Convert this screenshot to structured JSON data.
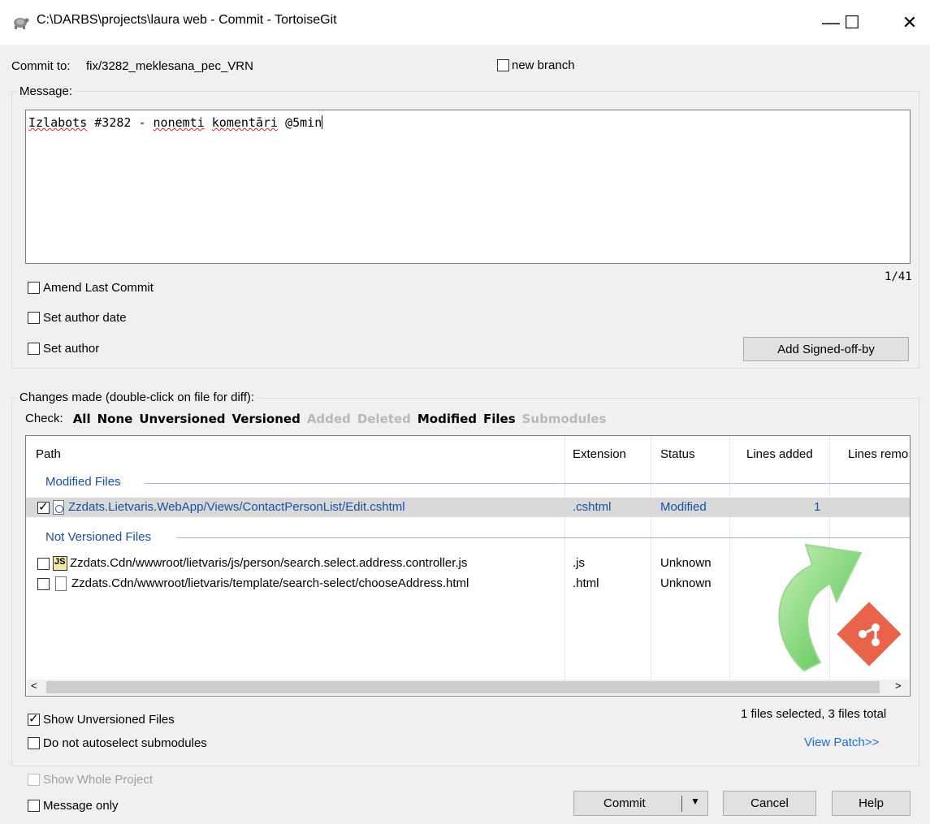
{
  "window": {
    "title": "C:\\DARBS\\projects\\laura web - Commit - TortoiseGit",
    "minimize": "—",
    "maximize": "☐",
    "close": "✕"
  },
  "commit_to": {
    "label": "Commit to:",
    "branch": "fix/3282_meklesana_pec_VRN",
    "new_branch_label": "new branch",
    "new_branch_checked": false
  },
  "message": {
    "group_label": "Message:",
    "text_parts": [
      "Izlabots",
      " #3282 - ",
      "nonemti",
      " ",
      "komentāri",
      " @5min"
    ],
    "counter": "1/41",
    "amend_label": "Amend Last Commit",
    "set_author_date_label": "Set author date",
    "set_author_label": "Set author",
    "signed_off_button": "Add Signed-off-by"
  },
  "changes": {
    "group_label": "Changes made (double-click on file for diff):",
    "check_label": "Check:",
    "check_items": [
      {
        "label": "All",
        "enabled": true
      },
      {
        "label": "None",
        "enabled": true
      },
      {
        "label": "Unversioned",
        "enabled": true
      },
      {
        "label": "Versioned",
        "enabled": true
      },
      {
        "label": "Added",
        "enabled": false
      },
      {
        "label": "Deleted",
        "enabled": false
      },
      {
        "label": "Modified",
        "enabled": true
      },
      {
        "label": "Files",
        "enabled": true
      },
      {
        "label": "Submodules",
        "enabled": false
      }
    ],
    "columns": [
      "Path",
      "Extension",
      "Status",
      "Lines added",
      "Lines remo"
    ],
    "groups": {
      "modified": "Modified Files",
      "not_versioned": "Not Versioned Files"
    },
    "files": [
      {
        "path": "Zzdats.Lietvaris.WebApp/Views/ContactPersonList/Edit.cshtml",
        "ext": ".cshtml",
        "status": "Modified",
        "lines_added": "1",
        "checked": true
      },
      {
        "path": "Zzdats.Cdn/wwwroot/lietvaris/js/person/search.select.address.controller.js",
        "ext": ".js",
        "status": "Unknown",
        "lines_added": "",
        "checked": false
      },
      {
        "path": "Zzdats.Cdn/wwwroot/lietvaris/template/search-select/chooseAddress.html",
        "ext": ".html",
        "status": "Unknown",
        "lines_added": "",
        "checked": false
      }
    ],
    "show_unversioned_label": "Show Unversioned Files",
    "show_unversioned_checked": true,
    "no_autoselect_label": "Do not autoselect submodules",
    "selection_summary": "1 files selected, 3 files total",
    "view_patch": "View Patch>>"
  },
  "bottom": {
    "show_whole_project_label": "Show Whole Project",
    "message_only_label": "Message only",
    "commit_button": "Commit",
    "cancel_button": "Cancel",
    "help_button": "Help"
  },
  "colors": {
    "accent_blue": "#1c4fa0",
    "link_blue": "#1a6fd6",
    "selected_row": "#d9d9d9"
  }
}
